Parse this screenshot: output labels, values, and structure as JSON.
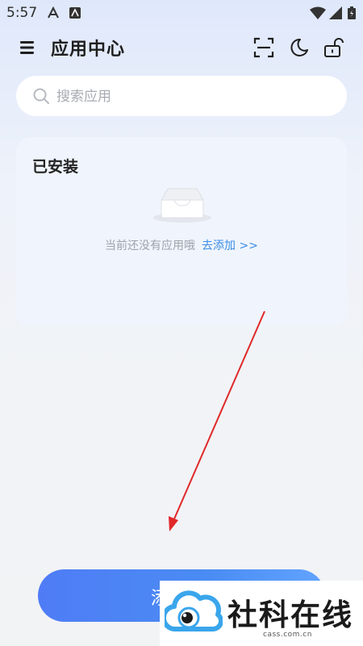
{
  "status_bar": {
    "time": "5:57",
    "icons": [
      "font-a-icon",
      "app-notification-icon",
      "wifi-icon",
      "signal-icon",
      "battery-icon"
    ]
  },
  "header": {
    "title": "应用中心",
    "icons": [
      "menu-icon",
      "scan-icon",
      "moon-icon",
      "unlock-icon"
    ]
  },
  "search": {
    "placeholder": "搜索应用",
    "value": ""
  },
  "installed": {
    "title": "已安装",
    "empty_text": "当前还没有应用哦",
    "add_link": "去添加 >>"
  },
  "add_button": {
    "label_visible": "添"
  },
  "watermark": {
    "title": "社科在线",
    "url": "cass.com.cn"
  },
  "colors": {
    "accent": "#4a8cf3",
    "link": "#3a8ee6",
    "arrow": "#e0282a",
    "logo_blue": "#3aa6ec"
  }
}
